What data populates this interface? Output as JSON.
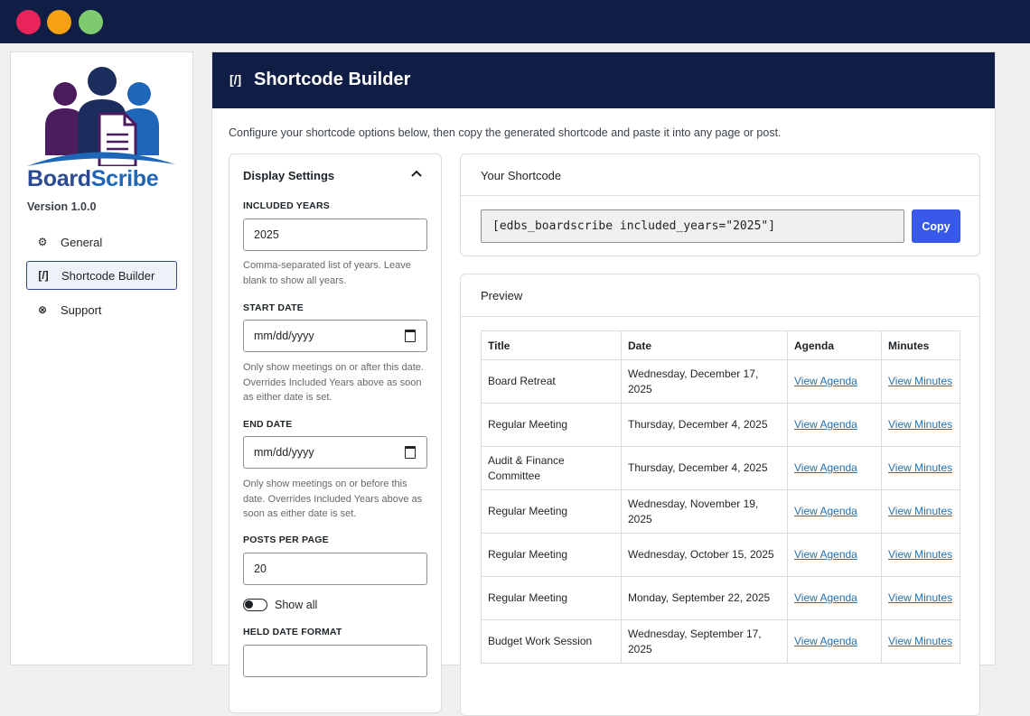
{
  "window": {
    "traffic_lights": {
      "close": "#e8245a",
      "minimize": "#f5a113",
      "zoom": "#7ecb6f"
    }
  },
  "sidebar": {
    "brand_part1": "Board",
    "brand_part2": "Scribe",
    "version": "Version 1.0.0",
    "items": [
      {
        "label": "General",
        "icon": "gear-icon",
        "glyph": "⚙",
        "active": false
      },
      {
        "label": "Shortcode Builder",
        "icon": "shortcode-icon",
        "glyph": "[/]",
        "active": true
      },
      {
        "label": "Support",
        "icon": "lifebuoy-icon",
        "glyph": "⊗",
        "active": false
      }
    ]
  },
  "header": {
    "icon_glyph": "[/]",
    "title": "Shortcode Builder"
  },
  "intro": "Configure your shortcode options below, then copy the generated shortcode and paste it into any page or post.",
  "settings": {
    "title": "Display Settings",
    "included_years": {
      "label": "INCLUDED YEARS",
      "value": "2025",
      "help": "Comma-separated list of years. Leave blank to show all years."
    },
    "start_date": {
      "label": "START DATE",
      "placeholder": "mm/dd/yyyy",
      "help": "Only show meetings on or after this date. Overrides Included Years above as soon as either date is set."
    },
    "end_date": {
      "label": "END DATE",
      "placeholder": "mm/dd/yyyy",
      "help": "Only show meetings on or before this date. Overrides Included Years above as soon as either date is set."
    },
    "posts_per_page": {
      "label": "POSTS PER PAGE",
      "value": "20"
    },
    "show_all": {
      "label": "Show all",
      "checked": false
    },
    "held_date_format": {
      "label": "HELD DATE FORMAT"
    }
  },
  "shortcode": {
    "title": "Your Shortcode",
    "value": "[edbs_boardscribe included_years=\"2025\"]",
    "copy_label": "Copy"
  },
  "preview": {
    "title": "Preview",
    "columns": [
      "Title",
      "Date",
      "Agenda",
      "Minutes"
    ],
    "rows": [
      {
        "title": "Board Retreat",
        "date": "Wednesday, December 17, 2025",
        "agenda": "View Agenda",
        "minutes": "View Minutes"
      },
      {
        "title": "Regular Meeting",
        "date": "Thursday, December 4, 2025",
        "agenda": "View Agenda",
        "minutes": "View Minutes"
      },
      {
        "title": "Audit & Finance Committee",
        "date": "Thursday, December 4, 2025",
        "agenda": "View Agenda",
        "minutes": "View Minutes"
      },
      {
        "title": "Regular Meeting",
        "date": "Wednesday, November 19, 2025",
        "agenda": "View Agenda",
        "minutes": "View Minutes"
      },
      {
        "title": "Regular Meeting",
        "date": "Wednesday, October 15, 2025",
        "agenda": "View Agenda",
        "minutes": "View Minutes"
      },
      {
        "title": "Regular Meeting",
        "date": "Monday, September 22, 2025",
        "agenda": "View Agenda",
        "minutes": "View Minutes"
      },
      {
        "title": "Budget Work Session",
        "date": "Wednesday, September 17, 2025",
        "agenda": "View Agenda",
        "minutes": "View Minutes"
      }
    ]
  },
  "colors": {
    "navy": "#101e45",
    "accent_blue": "#3858e9",
    "link": "#2271b1",
    "logo_purple": "#4b1d5e",
    "logo_navy": "#1b2d5c",
    "logo_blue": "#1e66b8"
  }
}
